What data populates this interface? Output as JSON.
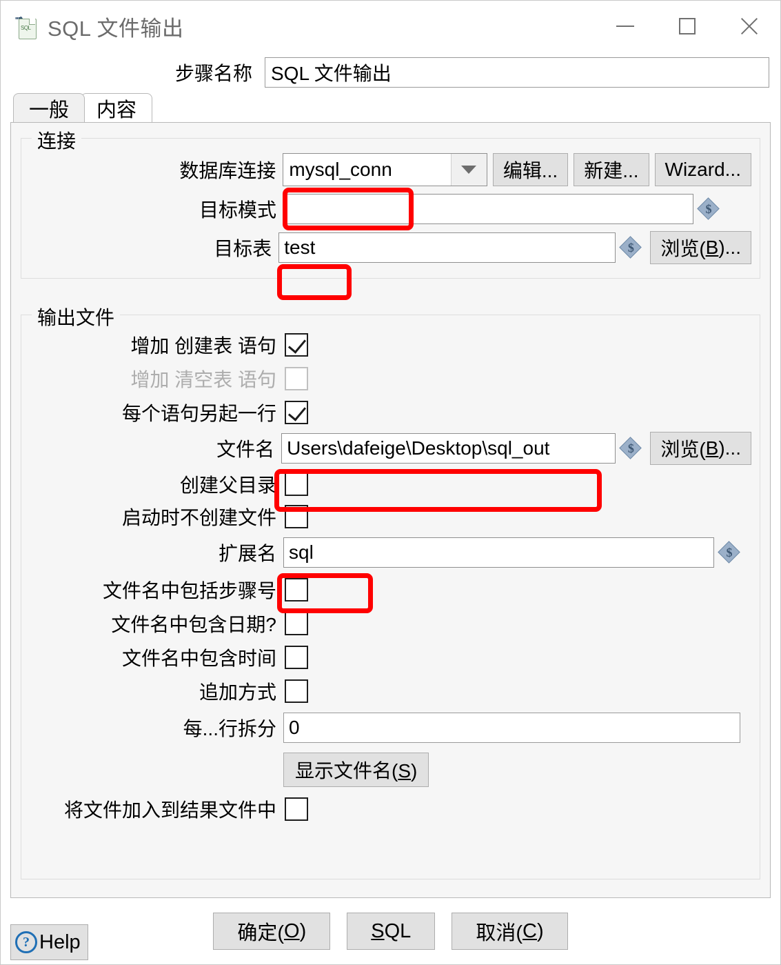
{
  "window": {
    "title": "SQL 文件输出",
    "icon": "sql-file-icon",
    "controls": {
      "minimize": "minimize-icon",
      "maximize": "maximize-icon",
      "close": "close-icon"
    }
  },
  "step": {
    "label": "步骤名称",
    "value": "SQL 文件输出"
  },
  "tabs": [
    {
      "label": "一般",
      "active": true
    },
    {
      "label": "内容",
      "active": false
    }
  ],
  "connection": {
    "legend": "连接",
    "db_label": "数据库连接",
    "db_value": "mysql_conn",
    "edit_button": "编辑...",
    "new_button": "新建...",
    "wizard_button": "Wizard...",
    "schema_label": "目标模式",
    "schema_value": "",
    "table_label": "目标表",
    "table_value": "test",
    "browse_button": "浏览(B)..."
  },
  "output": {
    "legend": "输出文件",
    "create_table_label": "增加 创建表 语句",
    "create_table_checked": true,
    "truncate_label": "增加 清空表 语句",
    "truncate_checked": false,
    "truncate_disabled": true,
    "newline_label": "每个语句另起一行",
    "newline_checked": true,
    "filename_label": "文件名",
    "filename_value": "Users\\dafeige\\Desktop\\sql_out",
    "filename_browse": "浏览(B)...",
    "create_parent_label": "创建父目录",
    "create_parent_checked": false,
    "no_create_at_start_label": "启动时不创建文件",
    "no_create_at_start_checked": false,
    "extension_label": "扩展名",
    "extension_value": "sql",
    "include_stepnr_label": "文件名中包括步骤号",
    "include_stepnr_checked": false,
    "include_date_label": "文件名中包含日期?",
    "include_date_checked": false,
    "include_time_label": "文件名中包含时间",
    "include_time_checked": false,
    "append_label": "追加方式",
    "append_checked": false,
    "split_label": "每...行拆分",
    "split_value": "0",
    "show_filenames_button": "显示文件名(S)",
    "show_filenames_mnemonic": "S",
    "add_to_result_label": "将文件加入到结果文件中",
    "add_to_result_checked": false
  },
  "footer": {
    "ok_button": "确定(O)",
    "ok_mnemonic": "O",
    "sql_button": "SQL",
    "sql_mnemonic": "S",
    "cancel_button": "取消(C)",
    "cancel_mnemonic": "C",
    "help_button": "Help",
    "help_icon": "question-mark-icon"
  },
  "annotations": {
    "color": "#ff0000",
    "boxes": [
      {
        "target": "db-connection-combo"
      },
      {
        "target": "target-table-input"
      },
      {
        "target": "filename-input"
      },
      {
        "target": "extension-input"
      }
    ]
  }
}
